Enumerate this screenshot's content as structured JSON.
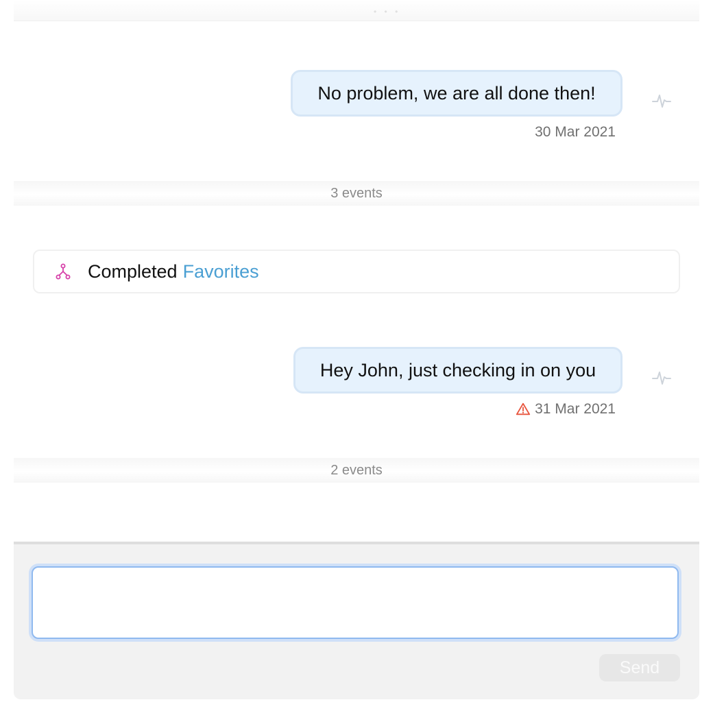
{
  "messages": [
    {
      "text": "No problem, we are all done then!",
      "timestamp": "30 Mar 2021",
      "status_icon": "none",
      "action_icon": "pulse-icon"
    },
    {
      "text": "Hey John, just checking in on you",
      "timestamp": "31 Mar 2021",
      "status_icon": "warning-icon",
      "action_icon": "pulse-icon"
    }
  ],
  "event_groups": [
    {
      "label": "3 events"
    },
    {
      "label": "2 events"
    }
  ],
  "event": {
    "icon": "flow-icon",
    "text": "Completed",
    "link": "Favorites"
  },
  "composer": {
    "value": "",
    "placeholder": "",
    "send_label": "Send"
  },
  "colors": {
    "bubble_bg": "#e6f2fd",
    "bubble_border": "#d6e6f6",
    "link": "#4a9fd3",
    "flow_icon": "#d63fa8",
    "warning": "#e8553e",
    "input_focus": "#8fb9ef"
  }
}
